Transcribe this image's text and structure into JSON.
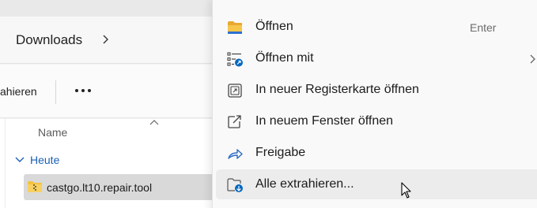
{
  "breadcrumb": {
    "current": "Downloads"
  },
  "toolbar": {
    "extract_label": "ahieren"
  },
  "file_list": {
    "column_name": "Name",
    "group": "Heute",
    "items": [
      {
        "name": "castgo.lt10.repair.tool",
        "icon": "zip-folder-icon"
      }
    ]
  },
  "context_menu": {
    "items": [
      {
        "label": "Öffnen",
        "shortcut": "Enter",
        "icon": "folder-icon"
      },
      {
        "label": "Öffnen mit",
        "icon": "open-with-icon",
        "has_submenu": true
      },
      {
        "label": "In neuer Registerkarte öffnen",
        "icon": "new-tab-icon"
      },
      {
        "label": "In neuem Fenster öffnen",
        "icon": "new-window-icon"
      },
      {
        "label": "Freigabe",
        "icon": "share-icon"
      },
      {
        "label": "Alle extrahieren...",
        "icon": "extract-all-icon",
        "hovered": true
      }
    ]
  },
  "colors": {
    "accent": "#0067c0",
    "folder_yellow": "#f3c23e",
    "group_text": "#1a5fb4",
    "selected_row": "#d9d9d9"
  }
}
